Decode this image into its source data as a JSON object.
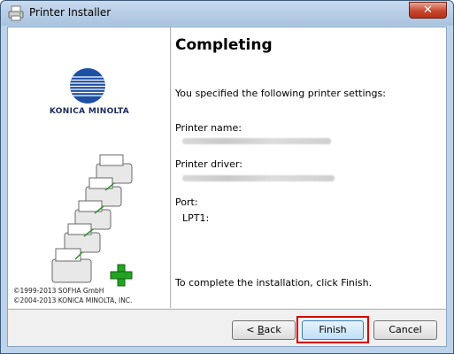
{
  "window": {
    "title": "Printer Installer",
    "close_label": "✕"
  },
  "left": {
    "brand": "KONICA MINOLTA",
    "copyright_1": "©1999-2013 SOFHA GmbH",
    "copyright_2": "©2004-2013 KONICA MINOLTA, INC."
  },
  "main": {
    "heading": "Completing",
    "intro": "You specified the following printer settings:",
    "printer_name_label": "Printer name:",
    "printer_driver_label": "Printer driver:",
    "port_label": "Port:",
    "port_value": "LPT1:",
    "footer_text": "To complete the installation, click Finish."
  },
  "buttons": {
    "back_prefix": "< ",
    "back_underlined": "B",
    "back_suffix": "ack",
    "finish": "Finish",
    "cancel": "Cancel"
  }
}
